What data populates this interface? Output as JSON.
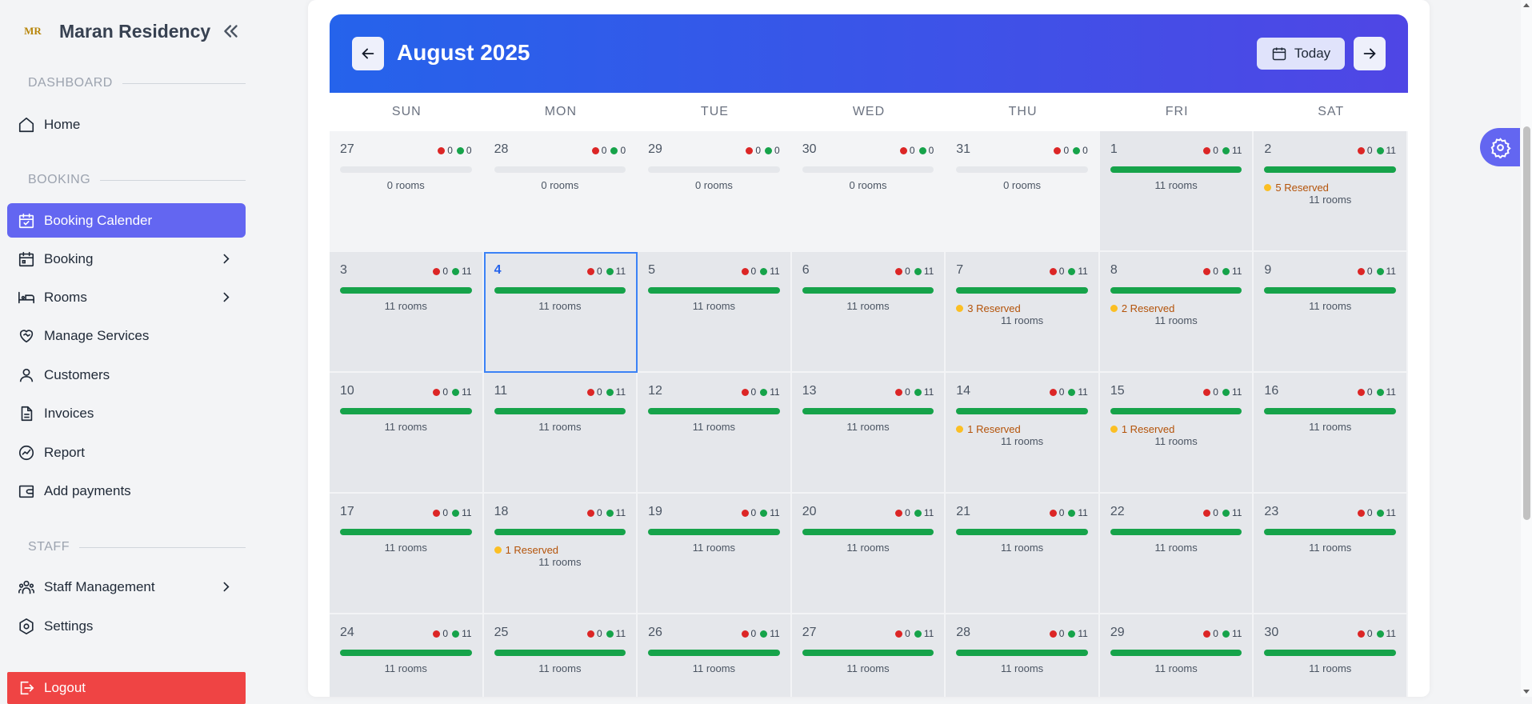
{
  "sidebar": {
    "logo_text": "MR",
    "brand": "Maran Residency",
    "sections": {
      "dashboard": "DASHBOARD",
      "booking": "BOOKING",
      "staff": "STAFF"
    },
    "items": {
      "home": "Home",
      "booking_calendar": "Booking Calender",
      "booking": "Booking",
      "rooms": "Rooms",
      "manage_services": "Manage Services",
      "customers": "Customers",
      "invoices": "Invoices",
      "report": "Report",
      "add_payments": "Add payments",
      "staff_management": "Staff Management",
      "settings": "Settings",
      "logout": "Logout"
    }
  },
  "calendar": {
    "month_label": "August 2025",
    "today_label": "Today",
    "weekdays": [
      "SUN",
      "MON",
      "TUE",
      "WED",
      "THU",
      "FRI",
      "SAT"
    ],
    "colors": {
      "accent": "#6366f1",
      "header_from": "#2563eb",
      "header_to": "#4f46e5",
      "available": "#16a34a",
      "booked": "#dc2626",
      "reserved": "#fbbf24"
    },
    "days": [
      {
        "day": "27",
        "booked": "0",
        "available": "0",
        "rooms": "0 rooms",
        "other": true
      },
      {
        "day": "28",
        "booked": "0",
        "available": "0",
        "rooms": "0 rooms",
        "other": true
      },
      {
        "day": "29",
        "booked": "0",
        "available": "0",
        "rooms": "0 rooms",
        "other": true
      },
      {
        "day": "30",
        "booked": "0",
        "available": "0",
        "rooms": "0 rooms",
        "other": true
      },
      {
        "day": "31",
        "booked": "0",
        "available": "0",
        "rooms": "0 rooms",
        "other": true
      },
      {
        "day": "1",
        "booked": "0",
        "available": "11",
        "rooms": "11 rooms"
      },
      {
        "day": "2",
        "booked": "0",
        "available": "11",
        "rooms": "11 rooms",
        "reserved": "5 Reserved"
      },
      {
        "day": "3",
        "booked": "0",
        "available": "11",
        "rooms": "11 rooms"
      },
      {
        "day": "4",
        "booked": "0",
        "available": "11",
        "rooms": "11 rooms",
        "today": true
      },
      {
        "day": "5",
        "booked": "0",
        "available": "11",
        "rooms": "11 rooms"
      },
      {
        "day": "6",
        "booked": "0",
        "available": "11",
        "rooms": "11 rooms"
      },
      {
        "day": "7",
        "booked": "0",
        "available": "11",
        "rooms": "11 rooms",
        "reserved": "3 Reserved"
      },
      {
        "day": "8",
        "booked": "0",
        "available": "11",
        "rooms": "11 rooms",
        "reserved": "2 Reserved"
      },
      {
        "day": "9",
        "booked": "0",
        "available": "11",
        "rooms": "11 rooms"
      },
      {
        "day": "10",
        "booked": "0",
        "available": "11",
        "rooms": "11 rooms"
      },
      {
        "day": "11",
        "booked": "0",
        "available": "11",
        "rooms": "11 rooms"
      },
      {
        "day": "12",
        "booked": "0",
        "available": "11",
        "rooms": "11 rooms"
      },
      {
        "day": "13",
        "booked": "0",
        "available": "11",
        "rooms": "11 rooms"
      },
      {
        "day": "14",
        "booked": "0",
        "available": "11",
        "rooms": "11 rooms",
        "reserved": "1 Reserved"
      },
      {
        "day": "15",
        "booked": "0",
        "available": "11",
        "rooms": "11 rooms",
        "reserved": "1 Reserved"
      },
      {
        "day": "16",
        "booked": "0",
        "available": "11",
        "rooms": "11 rooms"
      },
      {
        "day": "17",
        "booked": "0",
        "available": "11",
        "rooms": "11 rooms"
      },
      {
        "day": "18",
        "booked": "0",
        "available": "11",
        "rooms": "11 rooms",
        "reserved": "1 Reserved"
      },
      {
        "day": "19",
        "booked": "0",
        "available": "11",
        "rooms": "11 rooms"
      },
      {
        "day": "20",
        "booked": "0",
        "available": "11",
        "rooms": "11 rooms"
      },
      {
        "day": "21",
        "booked": "0",
        "available": "11",
        "rooms": "11 rooms"
      },
      {
        "day": "22",
        "booked": "0",
        "available": "11",
        "rooms": "11 rooms"
      },
      {
        "day": "23",
        "booked": "0",
        "available": "11",
        "rooms": "11 rooms"
      },
      {
        "day": "24",
        "booked": "0",
        "available": "11",
        "rooms": "11 rooms"
      },
      {
        "day": "25",
        "booked": "0",
        "available": "11",
        "rooms": "11 rooms"
      },
      {
        "day": "26",
        "booked": "0",
        "available": "11",
        "rooms": "11 rooms"
      },
      {
        "day": "27",
        "booked": "0",
        "available": "11",
        "rooms": "11 rooms"
      },
      {
        "day": "28",
        "booked": "0",
        "available": "11",
        "rooms": "11 rooms"
      },
      {
        "day": "29",
        "booked": "0",
        "available": "11",
        "rooms": "11 rooms"
      },
      {
        "day": "30",
        "booked": "0",
        "available": "11",
        "rooms": "11 rooms"
      }
    ]
  }
}
